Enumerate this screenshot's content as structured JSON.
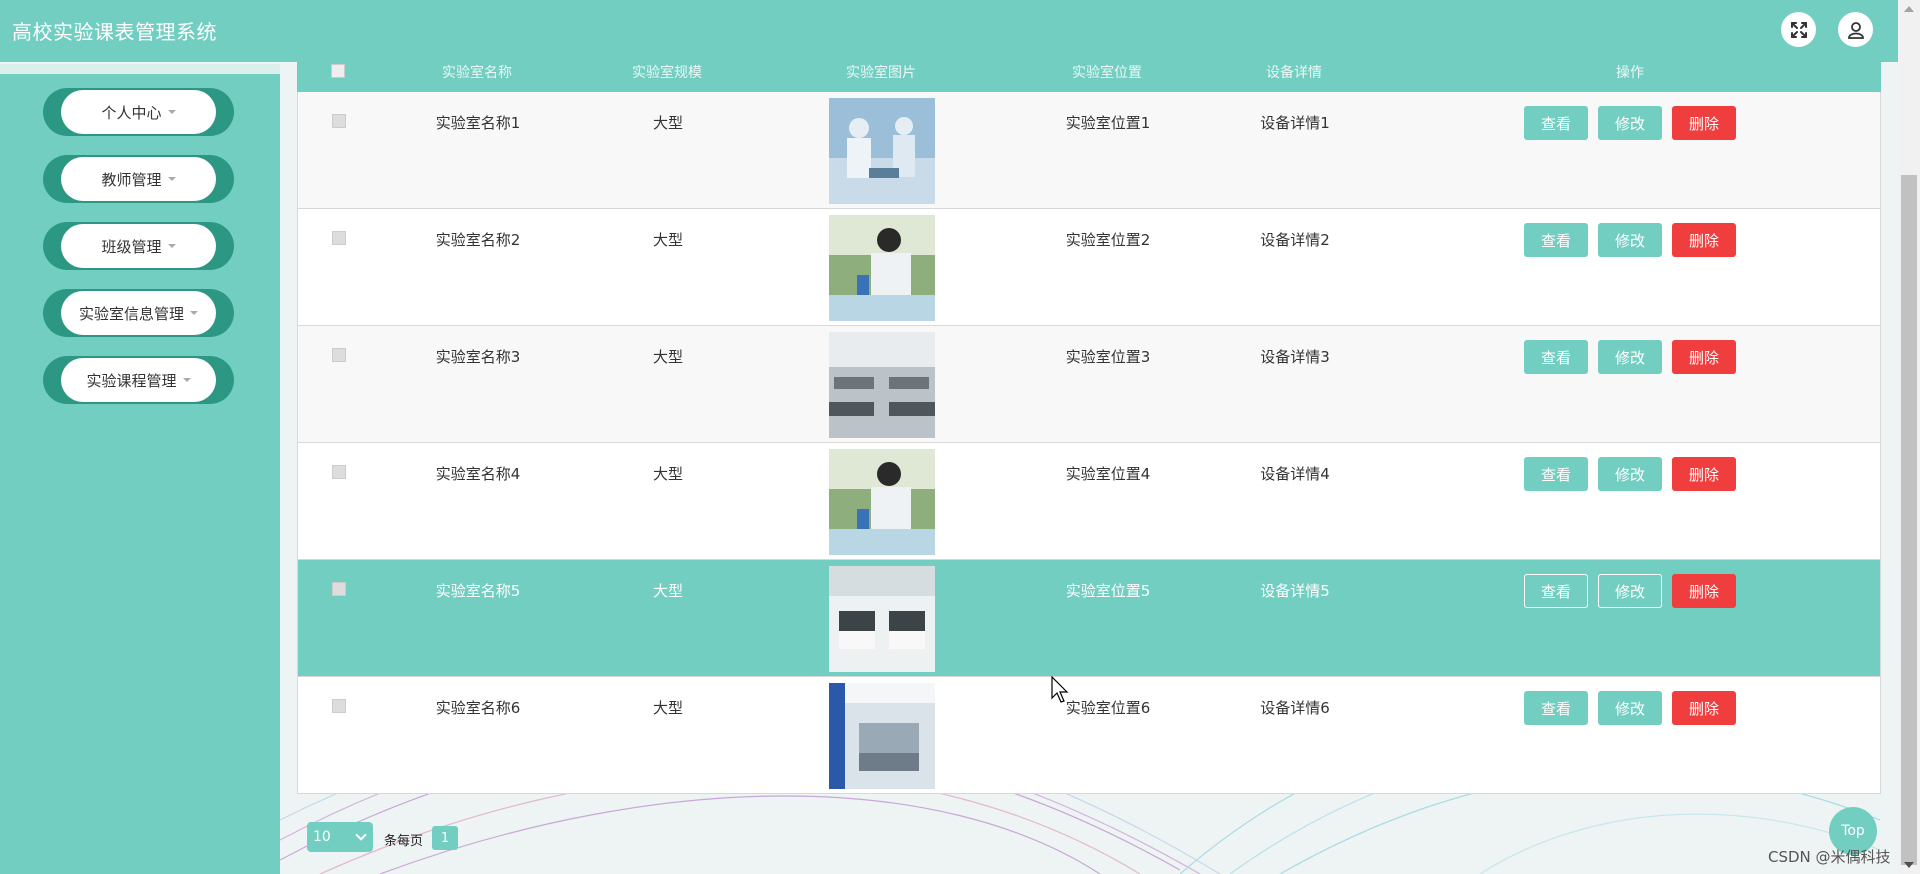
{
  "header": {
    "title": "高校实验课表管理系统",
    "fullscreen_icon": "expand-arrows-icon",
    "user_icon": "user-icon"
  },
  "sidebar": {
    "items": [
      {
        "label": "个人中心"
      },
      {
        "label": "教师管理"
      },
      {
        "label": "班级管理"
      },
      {
        "label": "实验室信息管理"
      },
      {
        "label": "实验课程管理"
      }
    ]
  },
  "table": {
    "columns": [
      "实验室名称",
      "实验室规模",
      "实验室图片",
      "实验室位置",
      "设备详情",
      "操作"
    ],
    "actions": {
      "view": "查看",
      "edit": "修改",
      "delete": "删除"
    },
    "rows": [
      {
        "name": "实验室名称1",
        "scale": "大型",
        "location": "实验室位置1",
        "equipment": "设备详情1"
      },
      {
        "name": "实验室名称2",
        "scale": "大型",
        "location": "实验室位置2",
        "equipment": "设备详情2"
      },
      {
        "name": "实验室名称3",
        "scale": "大型",
        "location": "实验室位置3",
        "equipment": "设备详情3"
      },
      {
        "name": "实验室名称4",
        "scale": "大型",
        "location": "实验室位置4",
        "equipment": "设备详情4"
      },
      {
        "name": "实验室名称5",
        "scale": "大型",
        "location": "实验室位置5",
        "equipment": "设备详情5"
      },
      {
        "name": "实验室名称6",
        "scale": "大型",
        "location": "实验室位置6",
        "equipment": "设备详情6"
      }
    ]
  },
  "pagination": {
    "page_size": "10",
    "per_page_label": "条每页",
    "current_page": "1"
  },
  "back_to_top": "Top",
  "watermark": "CSDN @米偶科技",
  "colors": {
    "primary": "#73cec2",
    "sidebar_accent": "#2c9884",
    "danger": "#f03e3e"
  }
}
